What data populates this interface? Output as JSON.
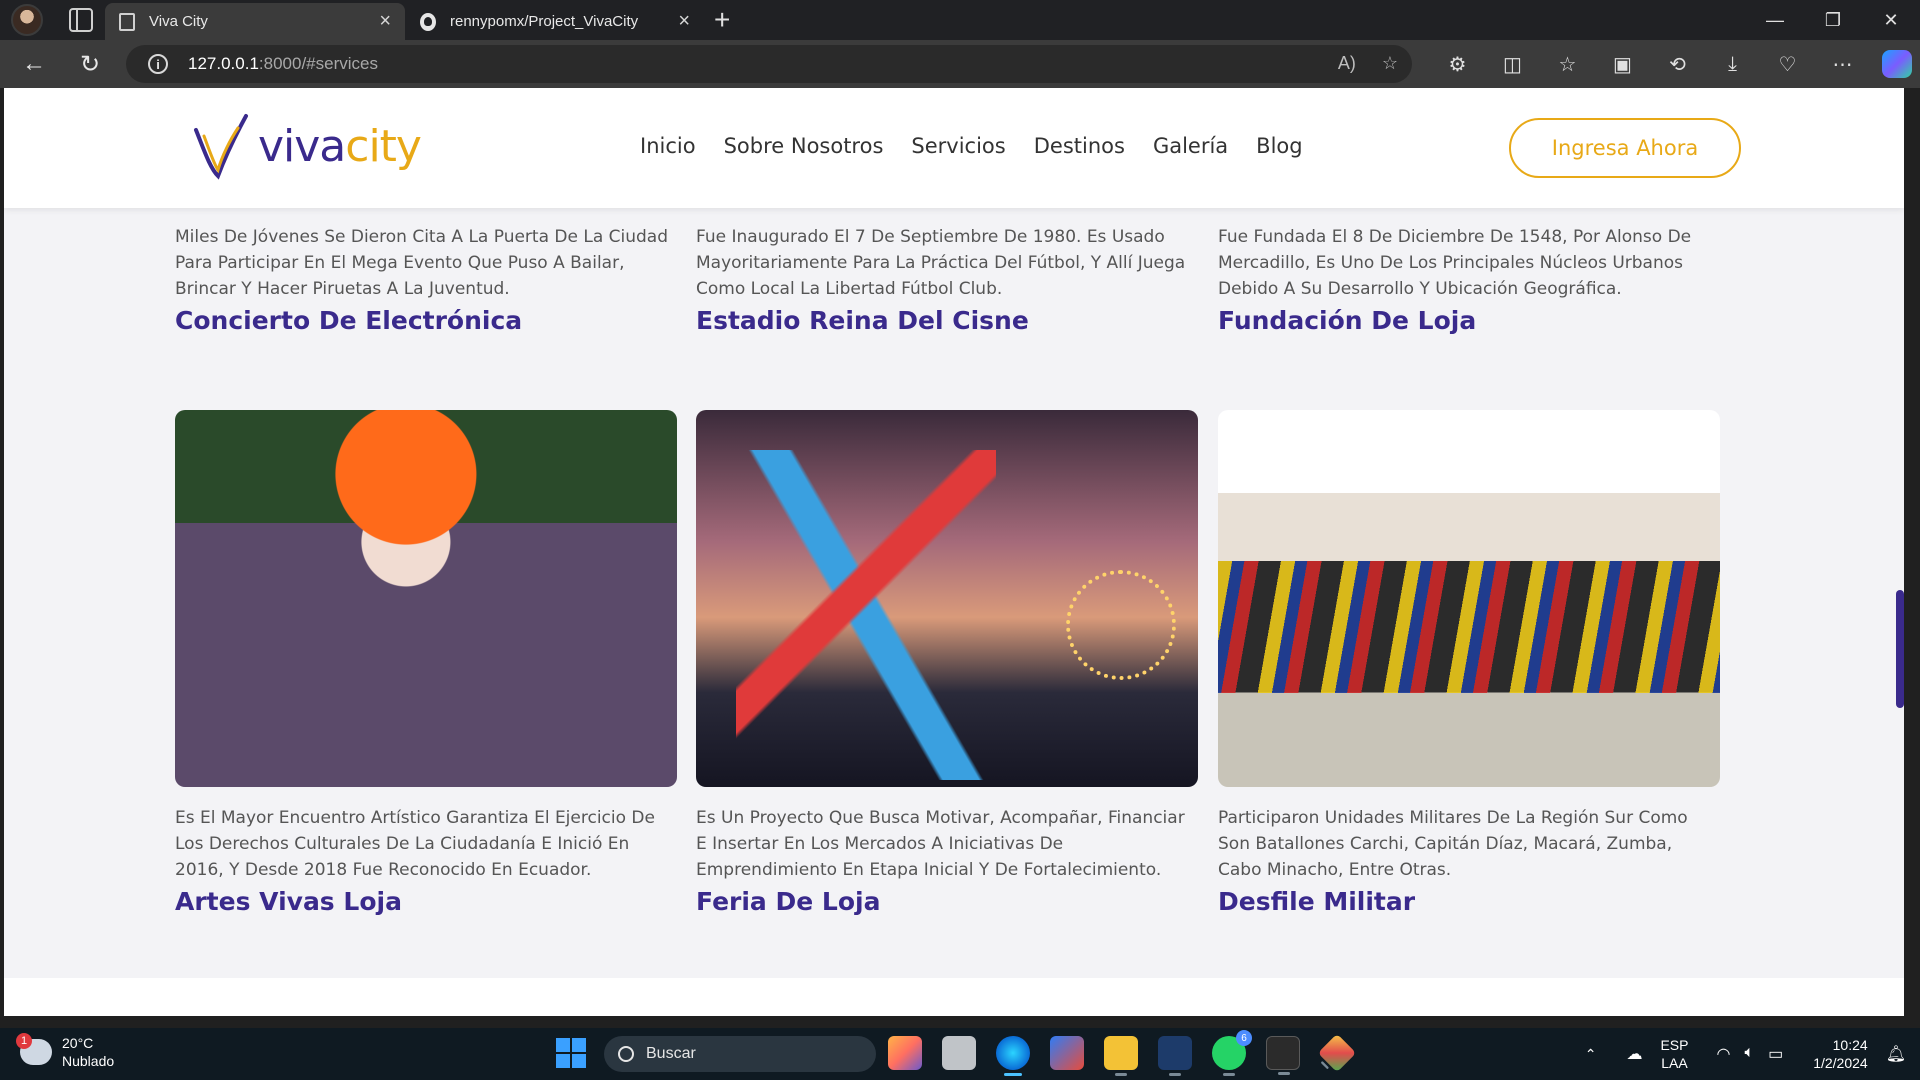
{
  "browser": {
    "tabs": [
      {
        "title": "Viva City",
        "active": true
      },
      {
        "title": "rennypomx/Project_VivaCity",
        "active": false
      }
    ],
    "address": {
      "host": "127.0.0.1",
      "rest": ":8000/#services"
    }
  },
  "site": {
    "logo": {
      "viva": "viva",
      "city": "city"
    },
    "nav": [
      "Inicio",
      "Sobre Nosotros",
      "Servicios",
      "Destinos",
      "Galería",
      "Blog"
    ],
    "cta": "Ingresa Ahora"
  },
  "cards": [
    {
      "desc": "Miles De Jóvenes Se Dieron Cita A La Puerta De La Ciudad Para Participar En El Mega Evento Que Puso A Bailar, Brincar Y Hacer Piruetas A La Juventud.",
      "title": "Concierto De Electrónica"
    },
    {
      "desc": "Fue Inaugurado El 7 De Septiembre De 1980. Es Usado Mayoritariamente Para La Práctica Del Fútbol, Y Allí Juega Como Local La Libertad Fútbol Club.",
      "title": "Estadio Reina Del Cisne"
    },
    {
      "desc": "Fue Fundada El 8 De Diciembre De 1548, Por Alonso De Mercadillo, Es Uno De Los Principales Núcleos Urbanos Debido A Su Desarrollo Y Ubicación Geográfica.",
      "title": "Fundación De Loja"
    },
    {
      "desc": "Es El Mayor Encuentro Artístico Garantiza El Ejercicio De Los Derechos Culturales De La Ciudadanía E Inició En 2016, Y Desde 2018 Fue Reconocido En Ecuador.",
      "title": "Artes Vivas Loja"
    },
    {
      "desc": "Es Un Proyecto Que Busca Motivar, Acompañar, Financiar E Insertar En Los Mercados A Iniciativas De Emprendimiento En Etapa Inicial Y De Fortalecimiento.",
      "title": "Feria De Loja"
    },
    {
      "desc": "Participaron Unidades Militares De La Región Sur Como Son Batallones Carchi, Capitán Díaz, Macará, Zumba, Cabo Minacho, Entre Otras.",
      "title": "Desfile Militar"
    }
  ],
  "taskbar": {
    "weather": {
      "temp": "20°C",
      "condition": "Nublado",
      "badge": "1"
    },
    "search_placeholder": "Buscar",
    "whatsapp_badge": "6",
    "lang": {
      "top": "ESP",
      "bottom": "LAA"
    },
    "clock": {
      "time": "10:24",
      "date": "1/2/2024"
    }
  }
}
